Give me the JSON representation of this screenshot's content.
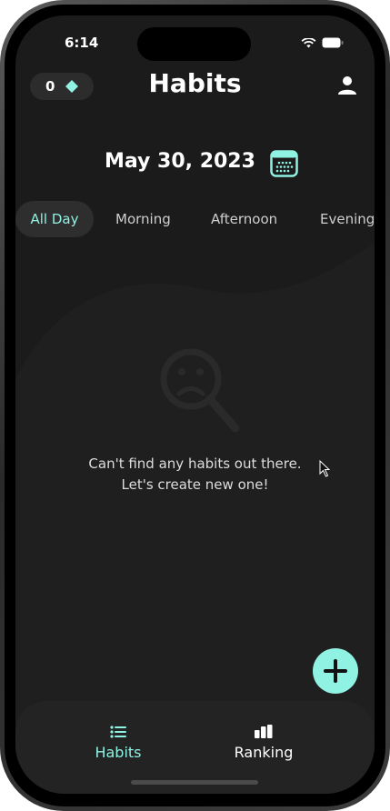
{
  "status_bar": {
    "time": "6:14",
    "icons": [
      "cellular-signal-icon",
      "wifi-icon",
      "battery-icon"
    ]
  },
  "header": {
    "gem_count": "0",
    "gem_icon": "diamond-icon",
    "title": "Habits",
    "profile_icon": "person-icon"
  },
  "date_section": {
    "date": "May 30, 2023",
    "calendar_icon": "calendar-icon"
  },
  "tabs": [
    {
      "label": "All Day",
      "active": true
    },
    {
      "label": "Morning",
      "active": false
    },
    {
      "label": "Afternoon",
      "active": false
    },
    {
      "label": "Evening",
      "active": false
    }
  ],
  "empty_state": {
    "icon": "sad-magnifier-icon",
    "line1": "Can't find any habits out there.",
    "line2": "Let's create new one!"
  },
  "fab": {
    "icon": "plus-icon"
  },
  "bottom_nav": {
    "items": [
      {
        "label": "Habits",
        "icon": "list-icon",
        "active": true
      },
      {
        "label": "Ranking",
        "icon": "bar-chart-icon",
        "active": false
      }
    ]
  },
  "colors": {
    "accent": "#8ff2e3",
    "background": "#1b1b1b",
    "surface": "#232323",
    "text": "#ffffff"
  }
}
